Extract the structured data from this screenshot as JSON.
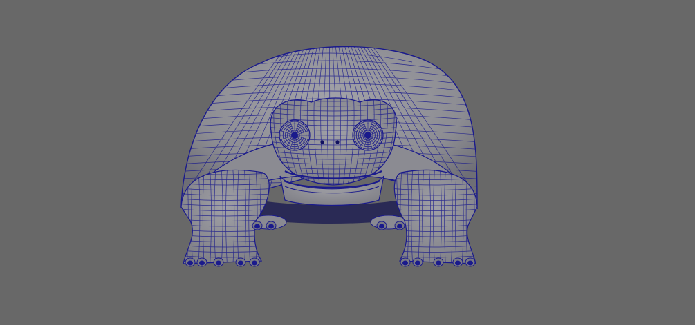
{
  "viewport": {
    "background_color": "#686868",
    "model": {
      "subject": "turtle",
      "display_mode": "wireframe-on-shaded",
      "surface_color": "#8e8e94",
      "wire_color": "#1a1a8c",
      "view": "front"
    }
  }
}
